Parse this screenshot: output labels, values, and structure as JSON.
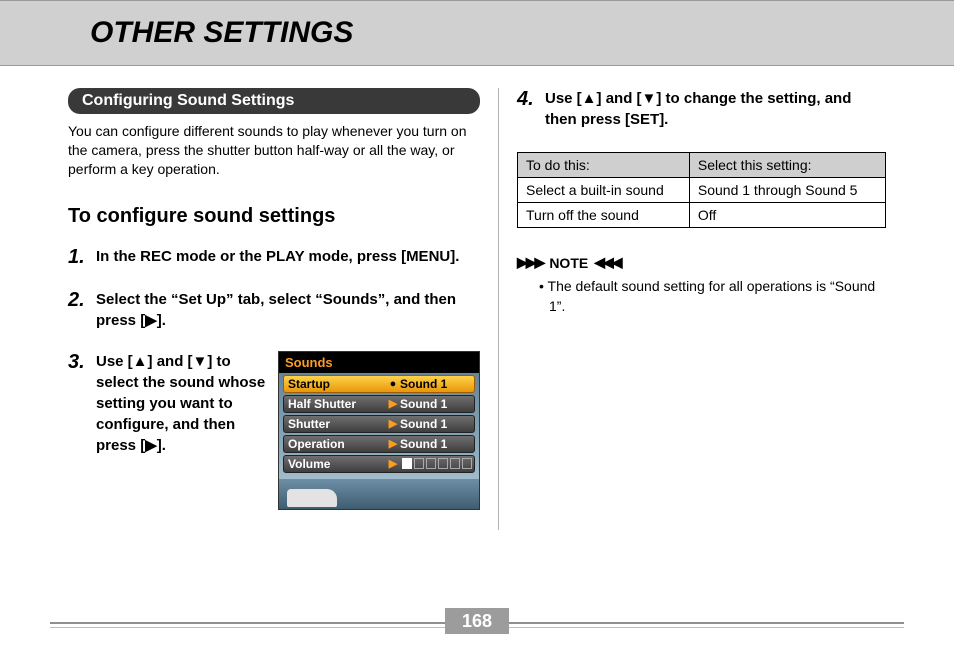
{
  "header": {
    "title": "OTHER SETTINGS"
  },
  "section": {
    "label": "Configuring Sound Settings"
  },
  "intro": "You can configure different sounds to play whenever you turn on the camera, press the shutter button half-way or all the way, or perform a key operation.",
  "subhead": "To configure sound settings",
  "steps": {
    "1": "In the REC mode or the PLAY mode, press [MENU].",
    "2": "Select the “Set Up” tab, select “Sounds”, and then press [▶].",
    "3": "Use [▲] and [▼] to select the sound whose setting you want to configure, and then press [▶].",
    "4": "Use [▲] and [▼] to change the setting, and then press [SET]."
  },
  "sounds_menu": {
    "title": "Sounds",
    "rows": [
      {
        "label": "Startup",
        "value": "Sound 1",
        "selected": true,
        "marker": "●"
      },
      {
        "label": "Half Shutter",
        "value": "Sound 1",
        "selected": false,
        "marker": "▶"
      },
      {
        "label": "Shutter",
        "value": "Sound 1",
        "selected": false,
        "marker": "▶"
      },
      {
        "label": "Operation",
        "value": "Sound 1",
        "selected": false,
        "marker": "▶"
      },
      {
        "label": "Volume",
        "value": "",
        "selected": false,
        "marker": "▶",
        "volume": true
      }
    ]
  },
  "table": {
    "headers": [
      "To do this:",
      "Select this setting:"
    ],
    "rows": [
      [
        "Select a built-in sound",
        "Sound 1 through Sound 5"
      ],
      [
        "Turn off the sound",
        "Off"
      ]
    ]
  },
  "note": {
    "label": "NOTE",
    "icons": {
      "left": "▶▶▶",
      "right": "◀◀◀"
    },
    "body": "• The default sound setting for all operations is “Sound 1”."
  },
  "page_number": "168"
}
